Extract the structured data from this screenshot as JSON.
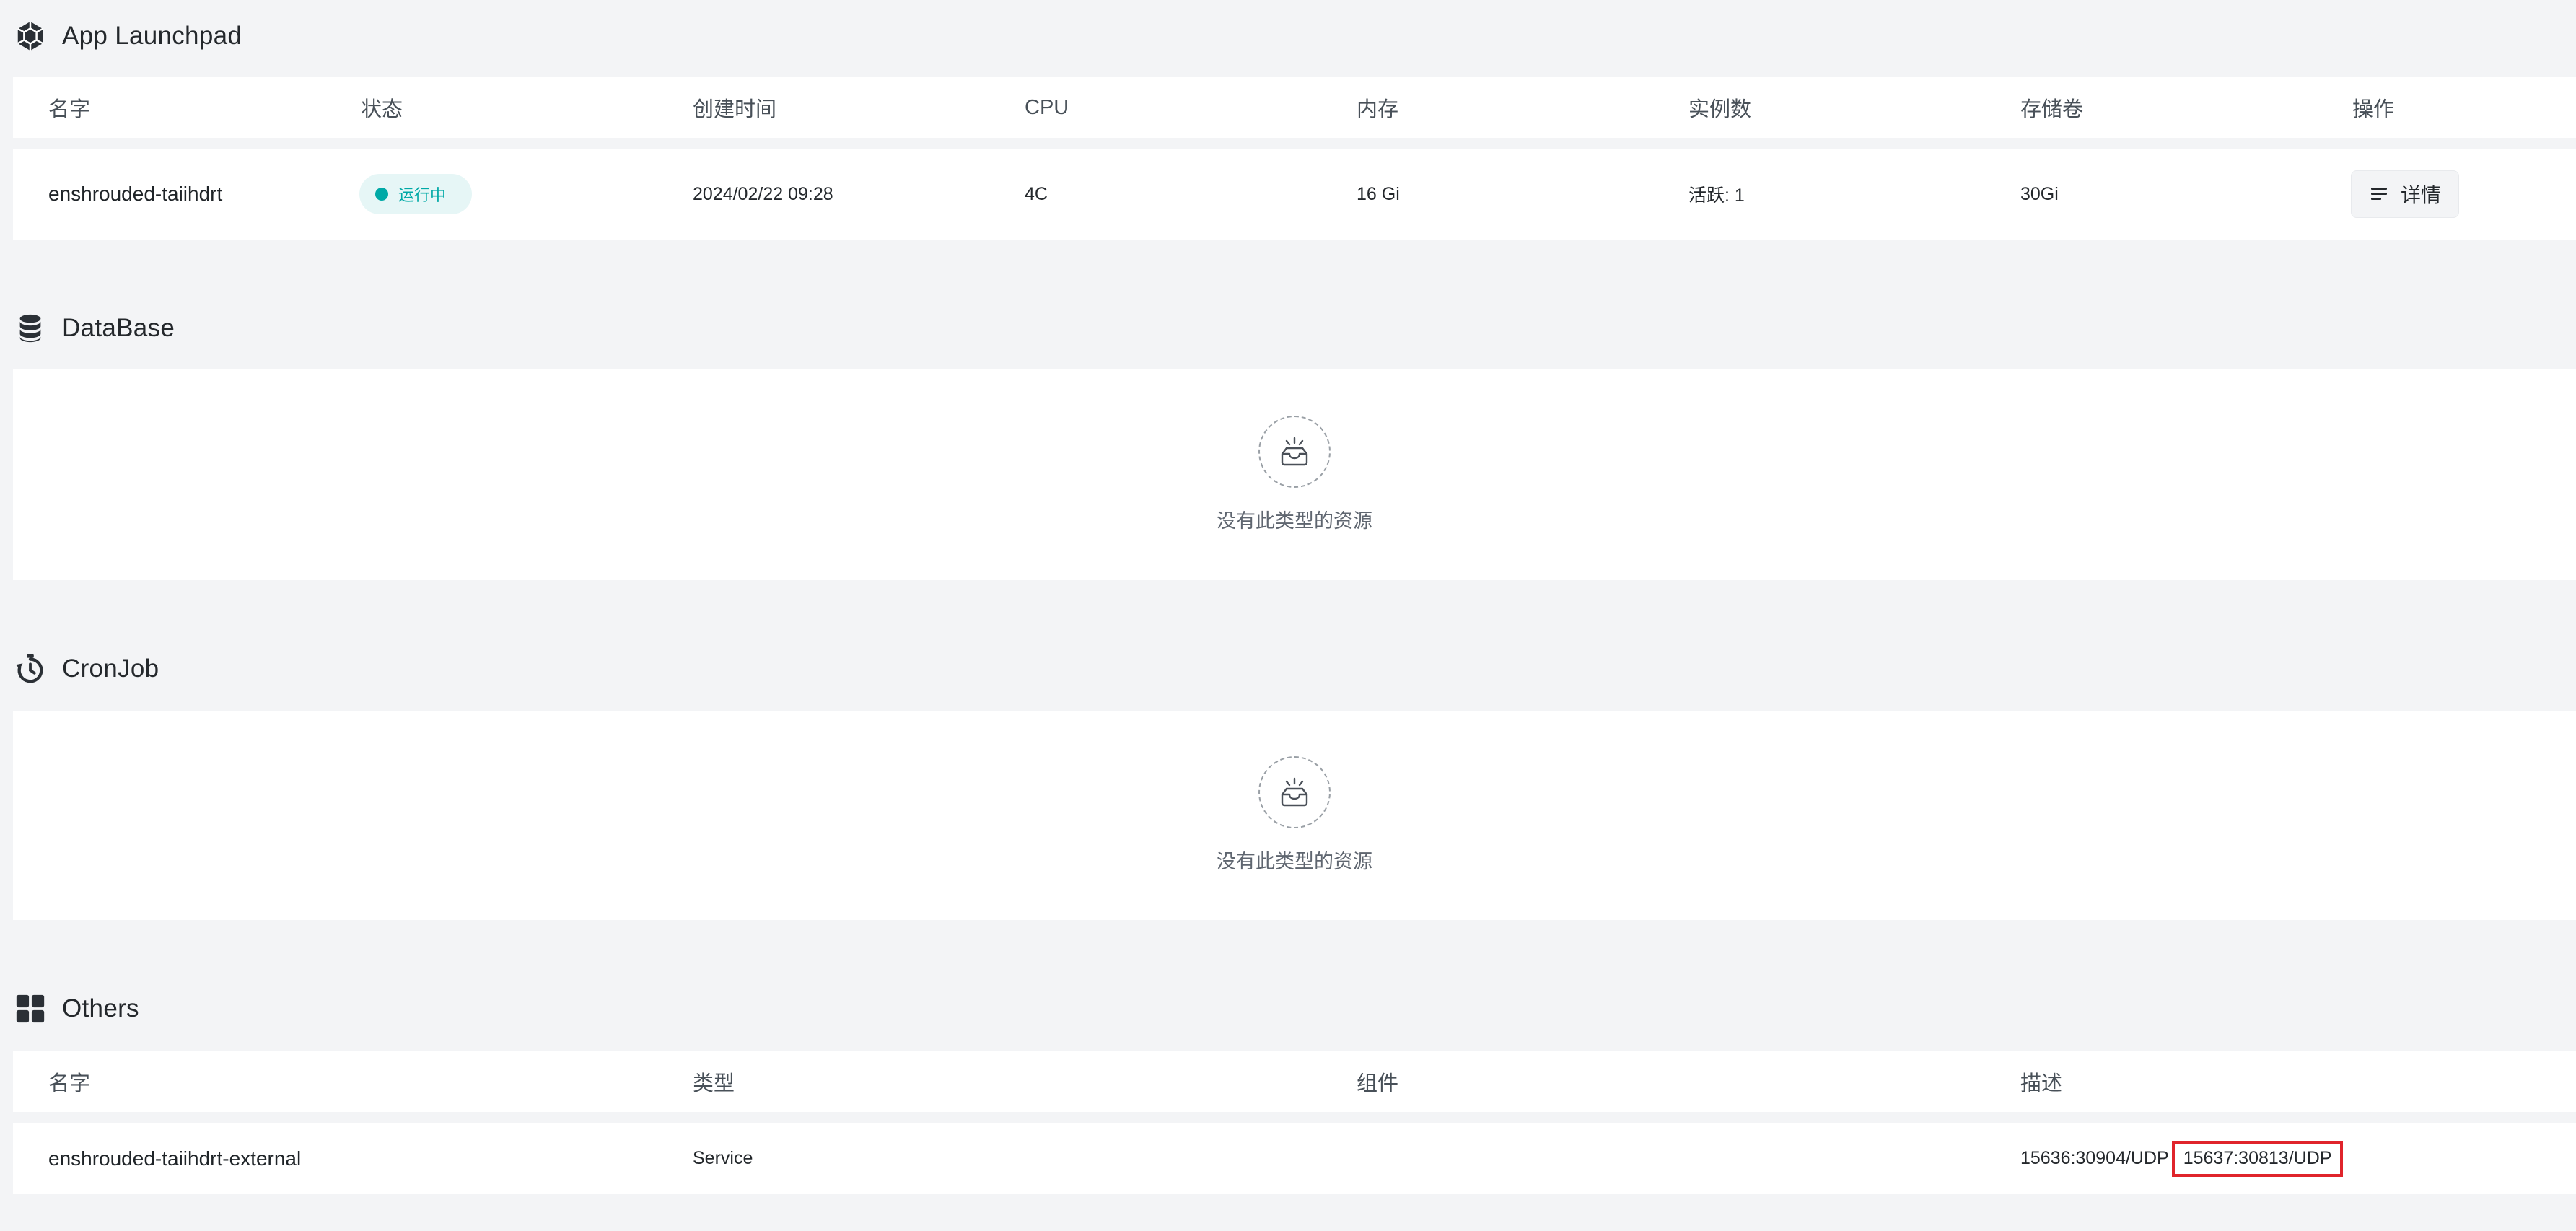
{
  "app_launchpad": {
    "title": "App Launchpad",
    "icon": "hexagon-app-icon",
    "columns": [
      "名字",
      "状态",
      "创建时间",
      "CPU",
      "内存",
      "实例数",
      "存储卷",
      "操作"
    ],
    "rows": [
      {
        "name": "enshrouded-taiihdrt",
        "status": "运行中",
        "created": "2024/02/22 09:28",
        "cpu": "4C",
        "memory": "16 Gi",
        "replicas": "活跃: 1",
        "storage": "30Gi",
        "action": "详情"
      }
    ]
  },
  "database": {
    "title": "DataBase",
    "icon": "database-icon",
    "empty_text": "没有此类型的资源"
  },
  "cronjob": {
    "title": "CronJob",
    "icon": "stopwatch-icon",
    "empty_text": "没有此类型的资源"
  },
  "others": {
    "title": "Others",
    "icon": "grid-icon",
    "columns": [
      "名字",
      "类型",
      "组件",
      "描述"
    ],
    "rows": [
      {
        "name": "enshrouded-taiihdrt-external",
        "type": "Service",
        "component": "",
        "description_port1": "15636:30904/UDP",
        "description_port2": "15637:30813/UDP"
      }
    ]
  },
  "colors": {
    "background": "#f3f4f6",
    "card": "#ffffff",
    "status_running": "#00a9a6",
    "status_running_bg": "#e6f6f6",
    "highlight": "#e0242b"
  }
}
